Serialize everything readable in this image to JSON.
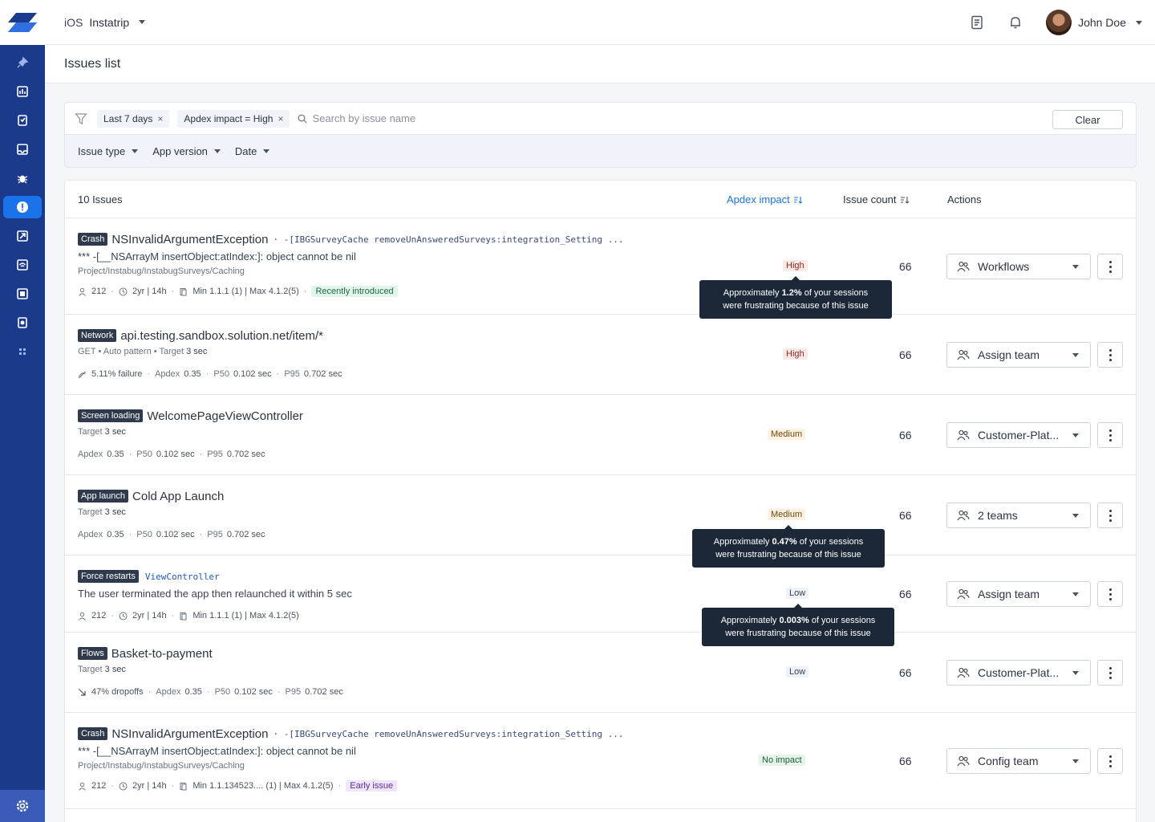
{
  "app": {
    "platform": "iOS",
    "name": "Instatrip",
    "user": "John Doe"
  },
  "page": {
    "title": "Issues list"
  },
  "filters": {
    "chips": [
      "Last 7 days",
      "Apdex impact = High"
    ],
    "search_placeholder": "Search by issue name",
    "clear_label": "Clear",
    "dropdowns": [
      "Issue type",
      "App version",
      "Date"
    ]
  },
  "table": {
    "count_label": "10 Issues",
    "col_apdex": "Apdex impact",
    "col_count": "Issue count",
    "col_actions": "Actions"
  },
  "tooltip_text": {
    "prefix": "Approximately",
    "suffix": "of your sessions",
    "line2": "were frustrating because of this issue"
  },
  "rows": [
    {
      "tag": "Crash",
      "title": "NSInvalidArgumentException",
      "ref": "· -[IBGSurveyCache removeUnAnsweredSurveys:integration_Setting ...",
      "sub1": "*** -[__NSArrayM insertObject:atIndex:]: object cannot be nil",
      "sub2": "Project/Instabug/InstabugSurveys/Caching",
      "meta": [
        "212",
        "2yr | 14h",
        "Min 1.1.1 (1) | Max 4.1.2(5)"
      ],
      "badge": "Recently introduced",
      "impact": "High",
      "count": "66",
      "team": "Workflows",
      "tooltip_pct": "1.2%"
    },
    {
      "tag": "Network",
      "title": "api.testing.sandbox.solution.net/item/*",
      "sub1": "GET • Auto pattern • Target",
      "sub1_value": "3 sec",
      "meta": [
        "5.11% failure",
        "Apdex",
        "0.35",
        "P50",
        "0.102 sec",
        "P95",
        "0.702 sec"
      ],
      "impact": "High",
      "count": "66",
      "team": "Assign team"
    },
    {
      "tag": "Screen loading",
      "title": "WelcomePageViewController",
      "sub1": "Target",
      "sub1_value": "3 sec",
      "meta": [
        "Apdex",
        "0.35",
        "P50",
        "0.102 sec",
        "P95",
        "0.702 sec"
      ],
      "impact": "Medium",
      "count": "66",
      "team": "Customer-Plat..."
    },
    {
      "tag": "App launch",
      "title": "Cold App Launch",
      "sub1": "Target",
      "sub1_value": "3 sec",
      "meta": [
        "Apdex",
        "0.35",
        "P50",
        "0.102 sec",
        "P95",
        "0.702 sec"
      ],
      "impact": "Medium",
      "count": "66",
      "team": "2 teams",
      "tooltip_pct": "0.47%"
    },
    {
      "tag": "Force restarts",
      "ref": "ViewController",
      "sub1": "The user terminated the app then relaunched it within 5 sec",
      "meta": [
        "212",
        "2yr | 14h",
        "Min 1.1.1 (1) | Max 4.1.2(5)"
      ],
      "impact": "Low",
      "count": "66",
      "team": "Assign team",
      "tooltip_pct": "0.003%"
    },
    {
      "tag": "Flows",
      "title": "Basket-to-payment",
      "sub1": "Target",
      "sub1_value": "3 sec",
      "meta": [
        "47% dropoffs",
        "Apdex",
        "0.35",
        "P50",
        "0.102 sec",
        "P95",
        "0.702 sec"
      ],
      "impact": "Low",
      "count": "66",
      "team": "Customer-Plat..."
    },
    {
      "tag": "Crash",
      "title": "NSInvalidArgumentException",
      "ref": "· -[IBGSurveyCache removeUnAnsweredSurveys:integration_Setting ...",
      "sub1": "*** -[__NSArrayM insertObject:atIndex:]: object cannot be nil",
      "sub2": "Project/Instabug/InstabugSurveys/Caching",
      "meta": [
        "212",
        "2yr | 14h",
        "Min 1.1.134523.... (1) | Max 4.1.2(5)"
      ],
      "badge": "Early issue",
      "impact": "No impact",
      "count": "66",
      "team": "Config team"
    }
  ]
}
